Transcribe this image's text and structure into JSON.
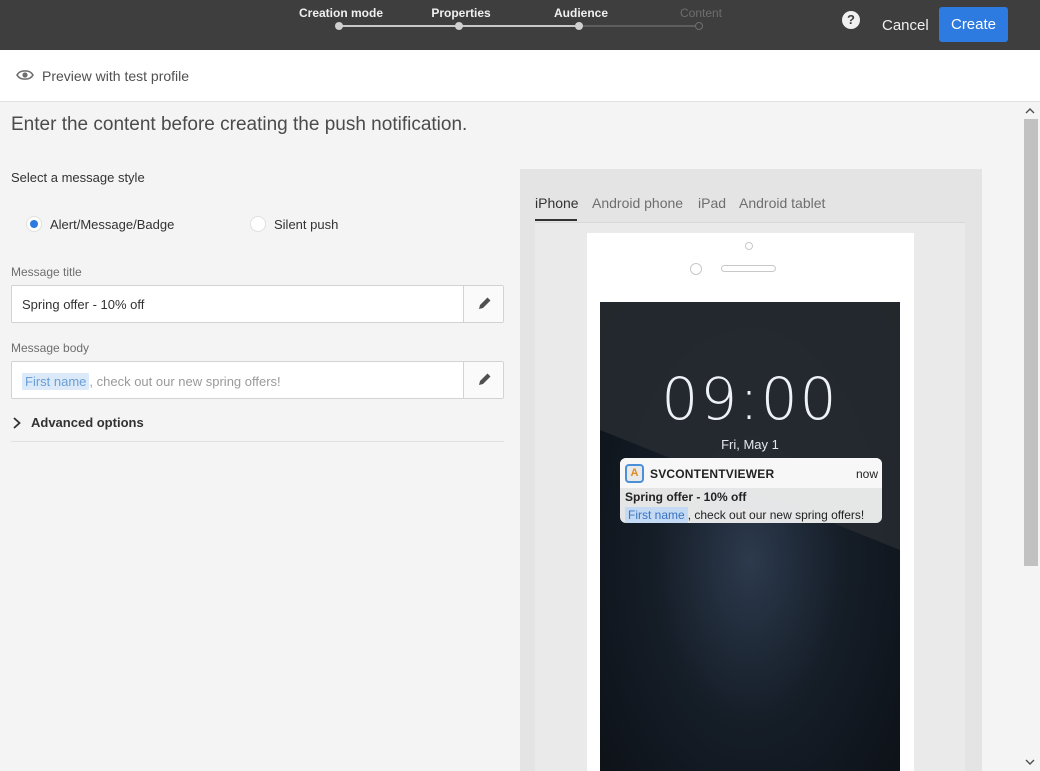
{
  "wizard": {
    "steps": [
      {
        "label": "Creation mode",
        "state": "done"
      },
      {
        "label": "Properties",
        "state": "done"
      },
      {
        "label": "Audience",
        "state": "done"
      },
      {
        "label": "Content",
        "state": "current"
      }
    ],
    "help_label": "?",
    "cancel_label": "Cancel",
    "create_label": "Create"
  },
  "preview": {
    "icon": "eye-icon",
    "label": "Preview with test profile"
  },
  "content": {
    "heading": "Enter the content before creating the push notification.",
    "style_label": "Select a message style",
    "styles": [
      {
        "label": "Alert/Message/Badge",
        "selected": true
      },
      {
        "label": "Silent push",
        "selected": false
      }
    ],
    "title_label": "Message title",
    "title_value": "Spring offer - 10% off",
    "body_label": "Message body",
    "body_chip": "First name",
    "body_rest": ", check out our new spring offers!",
    "advanced_label": "Advanced options"
  },
  "device_preview": {
    "tabs": [
      "iPhone",
      "Android phone",
      "iPad",
      "Android tablet"
    ],
    "active_tab": "iPhone",
    "clock": "09:00",
    "date": "Fri, May 1",
    "notification": {
      "app_icon_letter": "A",
      "app_name": "SVCONTENTVIEWER",
      "time": "now",
      "title": "Spring offer - 10% off",
      "body_chip": "First name",
      "body_rest": ", check out our new spring offers!"
    }
  },
  "colors": {
    "topbar": "#3e3e3e",
    "accent": "#2d7ae1",
    "background": "#f4f4f4"
  }
}
